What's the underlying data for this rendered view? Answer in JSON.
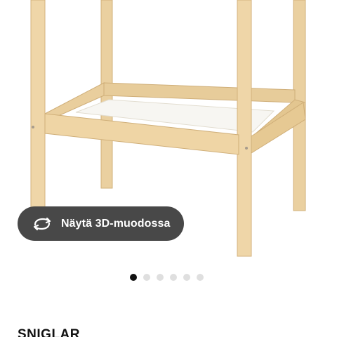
{
  "product": {
    "image_alt": "SNIGLAR",
    "name": "SNIGLAR"
  },
  "view_3d": {
    "label": "Näytä 3D-muodossa",
    "icon": "rotate-3d-icon"
  },
  "carousel": {
    "total": 6,
    "active_index": 0
  },
  "colors": {
    "wood": "#ecd3a3",
    "wood_shadow": "#d6b782",
    "button_bg": "#484848",
    "dot_active": "#111111",
    "dot_inactive": "#dfdfdf"
  }
}
